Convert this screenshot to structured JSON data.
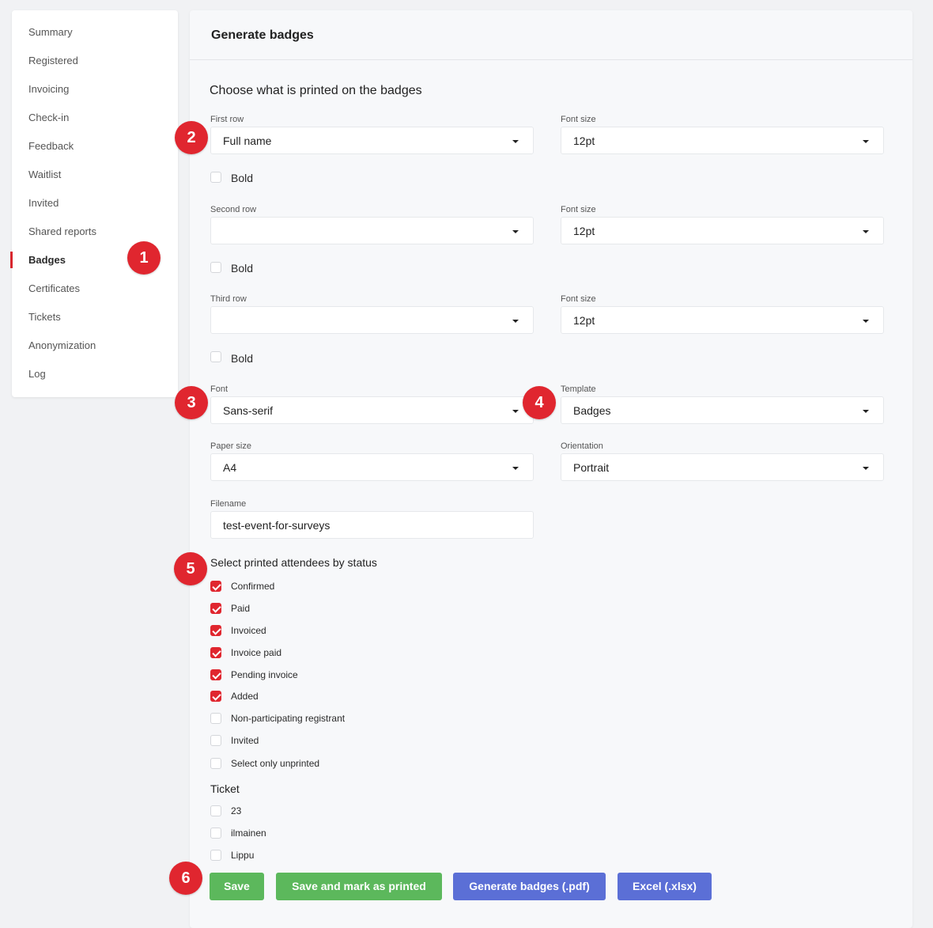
{
  "sidebar": {
    "items": [
      {
        "label": "Summary"
      },
      {
        "label": "Registered"
      },
      {
        "label": "Invoicing"
      },
      {
        "label": "Check-in"
      },
      {
        "label": "Feedback"
      },
      {
        "label": "Waitlist"
      },
      {
        "label": "Invited"
      },
      {
        "label": "Shared reports"
      },
      {
        "label": "Badges"
      },
      {
        "label": "Certificates"
      },
      {
        "label": "Tickets"
      },
      {
        "label": "Anonymization"
      },
      {
        "label": "Log"
      }
    ],
    "active": "Badges"
  },
  "panel": {
    "title": "Generate badges",
    "section_title": "Choose what is printed on the badges",
    "rows": [
      {
        "label": "First row",
        "value": "Full name",
        "font_size_label": "Font size",
        "font_size": "12pt",
        "bold_label": "Bold",
        "bold": false
      },
      {
        "label": "Second row",
        "value": "",
        "font_size_label": "Font size",
        "font_size": "12pt",
        "bold_label": "Bold",
        "bold": false
      },
      {
        "label": "Third row",
        "value": "",
        "font_size_label": "Font size",
        "font_size": "12pt",
        "bold_label": "Bold",
        "bold": false
      }
    ],
    "font": {
      "label": "Font",
      "value": "Sans-serif"
    },
    "template": {
      "label": "Template",
      "value": "Badges"
    },
    "paper_size": {
      "label": "Paper size",
      "value": "A4"
    },
    "orientation": {
      "label": "Orientation",
      "value": "Portrait"
    },
    "filename": {
      "label": "Filename",
      "value": "test-event-for-surveys"
    },
    "status": {
      "title": "Select printed attendees by status",
      "options": [
        {
          "label": "Confirmed",
          "checked": true
        },
        {
          "label": "Paid",
          "checked": true
        },
        {
          "label": "Invoiced",
          "checked": true
        },
        {
          "label": "Invoice paid",
          "checked": true
        },
        {
          "label": "Pending invoice",
          "checked": true
        },
        {
          "label": "Added",
          "checked": true
        },
        {
          "label": "Non-participating registrant",
          "checked": false
        },
        {
          "label": "Invited",
          "checked": false
        },
        {
          "label": "Select only unprinted",
          "checked": false
        }
      ]
    },
    "ticket": {
      "title": "Ticket",
      "options": [
        {
          "label": "23",
          "checked": false
        },
        {
          "label": "ilmainen",
          "checked": false
        },
        {
          "label": "Lippu",
          "checked": false
        }
      ]
    },
    "buttons": {
      "save": "Save",
      "save_mark": "Save and mark as printed",
      "generate_pdf": "Generate badges (.pdf)",
      "excel": "Excel (.xlsx)"
    }
  },
  "markers": [
    "1",
    "2",
    "3",
    "4",
    "5",
    "6"
  ],
  "colors": {
    "accent_red": "#e0262f",
    "button_green": "#5cb85c",
    "button_blue": "#5b6fd6"
  }
}
